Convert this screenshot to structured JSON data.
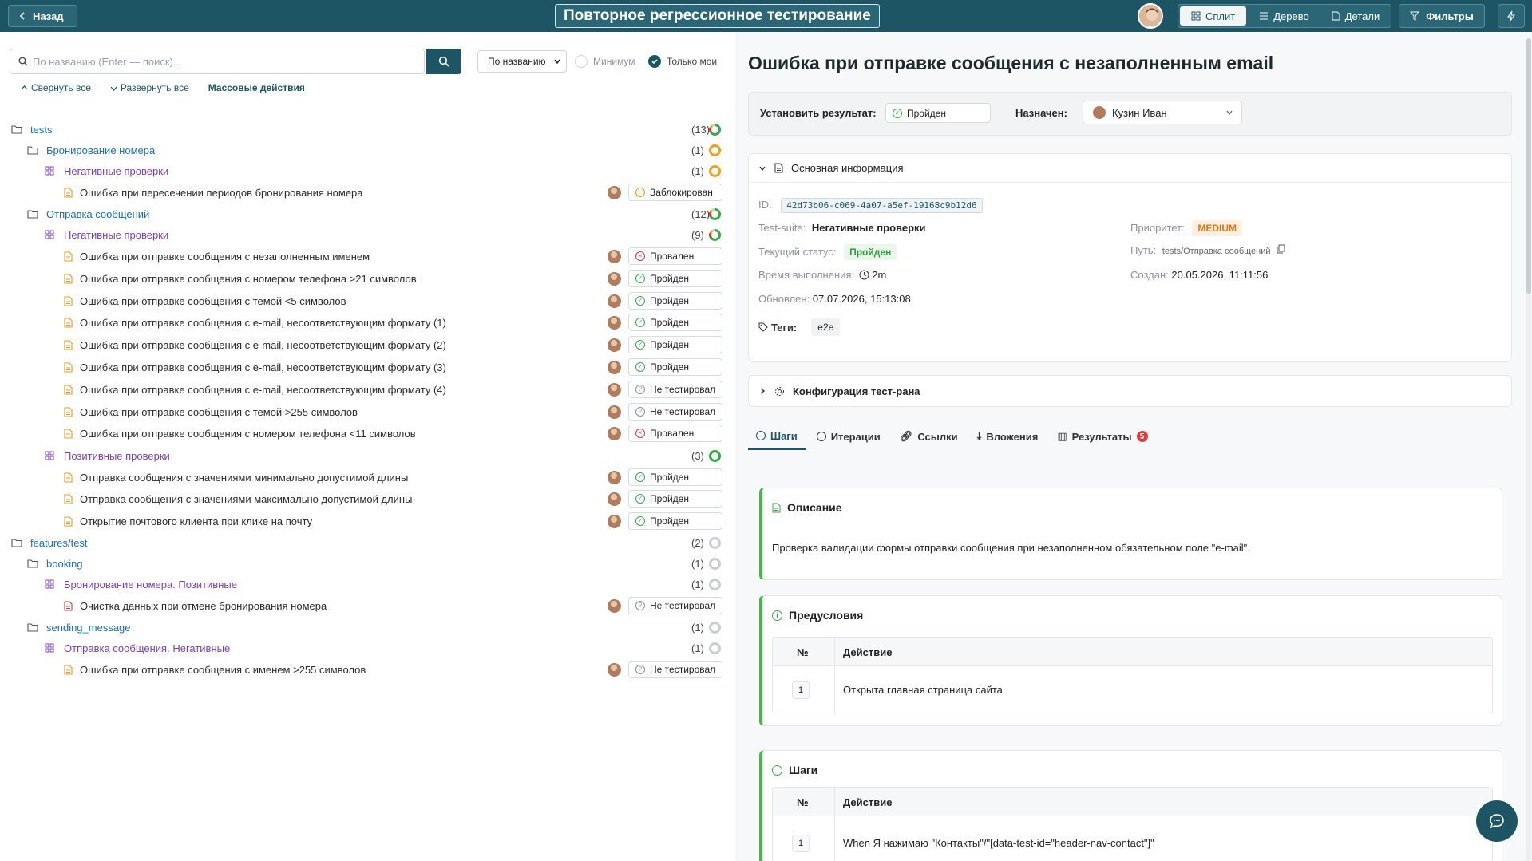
{
  "header": {
    "back_label": "Назад",
    "title": "Повторное регрессионное тестирование",
    "views": [
      "Сплит",
      "Дерево",
      "Детали"
    ],
    "filters_label": "Фильтры"
  },
  "toolbar": {
    "search_placeholder": "По названию (Enter — поиск)...",
    "sort_value": "По названию",
    "chk_min": "Минимум",
    "chk_mine": "Только мои",
    "collapse_all": "Свернуть все",
    "expand_all": "Развернуть все",
    "bulk": "Массовые действия"
  },
  "tree": [
    {
      "type": "folder",
      "level": 0,
      "label": "tests",
      "count": "(13)",
      "ring": "green-partial"
    },
    {
      "type": "folder",
      "level": 1,
      "label": "Бронирование номера",
      "count": "(1)",
      "ring": "orange"
    },
    {
      "type": "suite",
      "level": 2,
      "label": "Негативные проверки",
      "count": "(1)",
      "ring": "orange"
    },
    {
      "type": "case",
      "level": 3,
      "label": "Ошибка при пересечении периодов бронирования номера",
      "status": "Заблокирован",
      "st": "blocked"
    },
    {
      "type": "folder",
      "level": 1,
      "label": "Отправка сообщений",
      "count": "(12)",
      "ring": "green-partial"
    },
    {
      "type": "suite",
      "level": 2,
      "label": "Негативные проверки",
      "count": "(9)",
      "ring": "green-partial"
    },
    {
      "type": "case",
      "level": 3,
      "label": "Ошибка при отправке сообщения с незаполненным именем",
      "status": "Провален",
      "st": "failed"
    },
    {
      "type": "case",
      "level": 3,
      "label": "Ошибка при отправке сообщения с номером телефона >21 символов",
      "status": "Пройден",
      "st": "passed"
    },
    {
      "type": "case",
      "level": 3,
      "label": "Ошибка при отправке сообщения с темой <5 символов",
      "status": "Пройден",
      "st": "passed"
    },
    {
      "type": "case",
      "level": 3,
      "label": "Ошибка при отправке сообщения с e-mail, несоответствующим формату (1)",
      "status": "Пройден",
      "st": "passed"
    },
    {
      "type": "case",
      "level": 3,
      "label": "Ошибка при отправке сообщения с e-mail, несоответствующим формату (2)",
      "status": "Пройден",
      "st": "passed"
    },
    {
      "type": "case",
      "level": 3,
      "label": "Ошибка при отправке сообщения с e-mail, несоответствующим формату (3)",
      "status": "Пройден",
      "st": "passed"
    },
    {
      "type": "case",
      "level": 3,
      "label": "Ошибка при отправке сообщения с e-mail, несоответствующим формату (4)",
      "status": "Не тестировал",
      "st": "untested"
    },
    {
      "type": "case",
      "level": 3,
      "label": "Ошибка при отправке сообщения с темой >255 символов",
      "status": "Не тестировал",
      "st": "untested"
    },
    {
      "type": "case",
      "level": 3,
      "label": "Ошибка при отправке сообщения с номером телефона <11 символов",
      "status": "Провален",
      "st": "failed"
    },
    {
      "type": "suite",
      "level": 2,
      "label": "Позитивные проверки",
      "count": "(3)",
      "ring": "green"
    },
    {
      "type": "case",
      "level": 3,
      "label": "Отправка сообщения с значениями минимально допустимой длины",
      "status": "Пройден",
      "st": "passed"
    },
    {
      "type": "case",
      "level": 3,
      "label": "Отправка сообщения с значениями максимально допустимой длины",
      "status": "Пройден",
      "st": "passed"
    },
    {
      "type": "case",
      "level": 3,
      "label": "Открытие почтового клиента при клике на почту",
      "status": "Пройден",
      "st": "passed"
    },
    {
      "type": "folder",
      "level": 0,
      "label": "features/test",
      "count": "(2)",
      "ring": "gray"
    },
    {
      "type": "folder",
      "level": 1,
      "label": "booking",
      "count": "(1)",
      "ring": "gray"
    },
    {
      "type": "suite",
      "level": 2,
      "label": "Бронирование номера. Позитивные",
      "count": "(1)",
      "ring": "gray"
    },
    {
      "type": "case",
      "level": 3,
      "label": "Очистка данных при отмене бронирования номера",
      "status": "Не тестировал",
      "st": "untested",
      "red": true
    },
    {
      "type": "folder",
      "level": 1,
      "label": "sending_message",
      "count": "(1)",
      "ring": "gray"
    },
    {
      "type": "suite",
      "level": 2,
      "label": "Отправка сообщения. Негативные",
      "count": "(1)",
      "ring": "gray"
    },
    {
      "type": "case",
      "level": 3,
      "label": "Ошибка при отправке сообщения с именем >255 символов",
      "status": "Не тестировал",
      "st": "untested"
    }
  ],
  "detail": {
    "title": "Ошибка при отправке сообщения с незаполненным email",
    "set_result_label": "Установить результат:",
    "set_result_value": "Пройден",
    "assigned_label": "Назначен:",
    "assigned_value": "Кузин Иван",
    "main_info": "Основная информация",
    "id_label": "ID:",
    "id_value": "42d73b06-c069-4a07-a5ef-19168c9b12d6",
    "suite_label": "Test-suite:",
    "suite_value": "Негативные проверки",
    "priority_label": "Приоритет:",
    "priority_value": "MEDIUM",
    "status_label": "Текущий статус:",
    "status_value": "Пройден",
    "path_label": "Путь:",
    "path_value": "tests/Отправка сообщений",
    "time_label": "Время выполнения:",
    "time_value": "2m",
    "created_label": "Создан:",
    "created_value": "20.05.2026, 11:11:56",
    "updated_label": "Обновлен:",
    "updated_value": "07.07.2026, 15:13:08",
    "tags_label": "Теги:",
    "tag": "e2e",
    "config": "Конфигурация тест-рана",
    "tabs": [
      "Шаги",
      "Итерации",
      "Ссылки",
      "Вложения",
      "Результаты"
    ],
    "results_badge": "5",
    "desc_title": "Описание",
    "desc_text": "Проверка валидации формы отправки сообщения при незаполненном обязательном поле \"e-mail\".",
    "pre_title": "Предусловия",
    "col_no": "№",
    "col_action": "Действие",
    "pre_row_no": "1",
    "pre_row_text": "Открыта главная страница сайта",
    "steps_title": "Шаги",
    "step_row_no": "1",
    "step_row_text": "When Я нажимаю \"Контакты\"/\"[data-test-id=\"header-nav-contact\"]\""
  },
  "colors": {
    "header": "#1d5565",
    "folder": "#1a6fb5",
    "suite": "#7b3fb0",
    "passed": "#3aa64a",
    "failed": "#d9363e",
    "blocked": "#e89a1a",
    "untested": "#8a9399"
  }
}
